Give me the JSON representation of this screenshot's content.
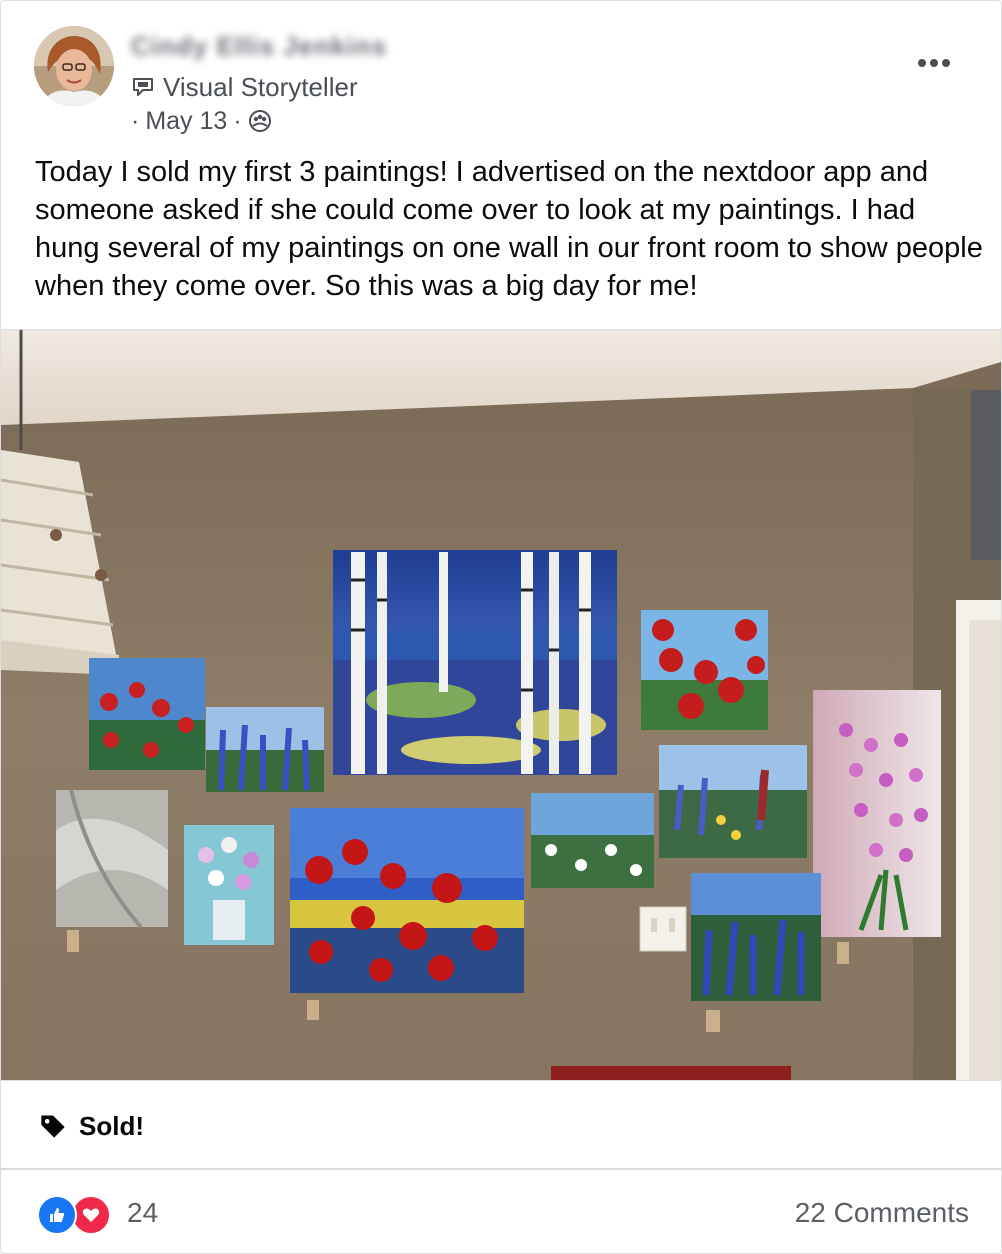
{
  "post": {
    "author_name": "Cindy Ellis Jenkins",
    "badge_label": "Visual Storyteller",
    "date": "May 13",
    "separator": "·",
    "text": "Today I sold my first 3 paintings! I advertised on the nextdoor app and someone asked if she could come over to look at my paintings. I had hung several of my paintings on one wall in our front room to show people when they come over. So this was a big day for me!",
    "sale_label": "Sold!",
    "icons": {
      "badge": "visual-storyteller-badge-icon",
      "audience": "group-audience-icon",
      "more": "more-options-icon",
      "tag": "price-tag-icon",
      "like": "like-reaction-icon",
      "love": "love-reaction-icon"
    }
  },
  "footer": {
    "reaction_count": "24",
    "comments_label": "22 Comments"
  },
  "colors": {
    "like_blue": "#1877f2",
    "love_red": "#f0284a",
    "wall": "#8d7d66",
    "ceiling": "#ece4da",
    "secondary_text": "#65676b"
  }
}
